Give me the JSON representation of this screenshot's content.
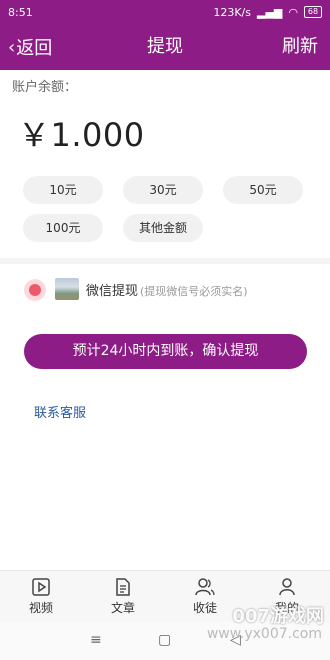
{
  "status": {
    "time": "8:51",
    "speed": "123K/s",
    "battery": "68"
  },
  "nav": {
    "back_label": "返回",
    "title": "提现",
    "right_label": "刷新"
  },
  "balance": {
    "label": "账户余额：",
    "value": "￥1.000"
  },
  "amounts": [
    "10元",
    "30元",
    "50元",
    "100元",
    "其他金额"
  ],
  "method": {
    "name": "微信提现",
    "hint": "(提现微信号必须实名)"
  },
  "confirm_button": "预计24小时内到账，确认提现",
  "service_link": "联系客服",
  "tabs": [
    {
      "label": "视频",
      "icon": "video-icon"
    },
    {
      "label": "文章",
      "icon": "article-icon"
    },
    {
      "label": "收徒",
      "icon": "apprentice-icon"
    },
    {
      "label": "我的",
      "icon": "profile-icon"
    }
  ],
  "watermark": {
    "text": "007游戏网",
    "url": "www.yx007.com"
  },
  "colors": {
    "primary": "#8e1c86",
    "radio": "#ef5a6a",
    "link": "#2a5aa0"
  }
}
